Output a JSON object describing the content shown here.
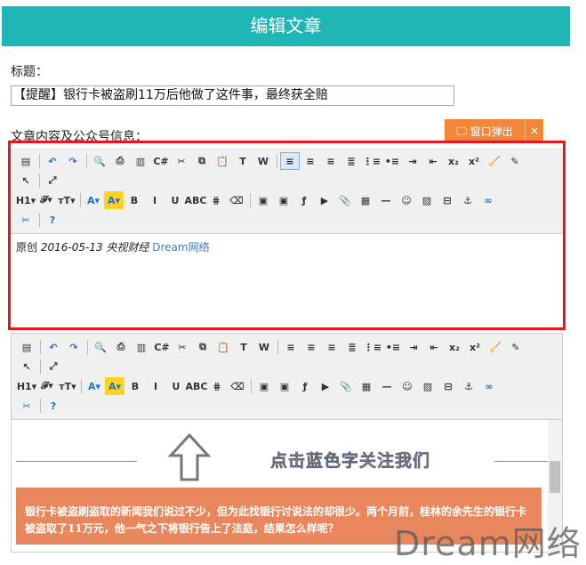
{
  "header": {
    "title": "编辑文章"
  },
  "form": {
    "title_label": "标题：",
    "title_value": "【提醒】银行卡被盗刷11万后他做了这件事，最终获全赔",
    "content_label": "文章内容及公众号信息：",
    "popout_label": "窗口弹出",
    "popout_close": "×"
  },
  "toolbar": {
    "row1": [
      [
        "source-icon",
        "▤"
      ],
      "|",
      [
        "undo-icon",
        "↶"
      ],
      [
        "redo-icon",
        "↷"
      ],
      "|",
      [
        "preview-icon",
        "🔍"
      ],
      [
        "print-icon",
        "⎙"
      ],
      [
        "template-icon",
        "▥"
      ],
      [
        "code-icon",
        "C#"
      ],
      [
        "cut-icon",
        "✂"
      ],
      [
        "copy-icon",
        "⧉"
      ],
      [
        "paste-icon",
        "📋"
      ],
      [
        "paste-text-icon",
        "T"
      ],
      [
        "paste-word-icon",
        "W"
      ],
      "|",
      [
        "align-left-icon",
        "≡"
      ],
      [
        "align-center-icon",
        "≡"
      ],
      [
        "align-right-icon",
        "≡"
      ],
      [
        "justify-icon",
        "≣"
      ],
      [
        "ordered-list-icon",
        "⋮≡"
      ],
      [
        "unordered-list-icon",
        "•≡"
      ],
      [
        "indent-icon",
        "⇥"
      ],
      [
        "outdent-icon",
        "⇤"
      ],
      [
        "subscript-icon",
        "x₂"
      ],
      [
        "superscript-icon",
        "x²"
      ],
      [
        "clear-format-icon",
        "🧹"
      ],
      [
        "select-all-icon",
        "✎"
      ]
    ],
    "row2": [
      [
        "pointer-icon",
        "↖"
      ],
      "|",
      [
        "fullscreen-icon",
        "⤢"
      ]
    ],
    "row3": [
      [
        "heading-icon",
        "H1▾"
      ],
      [
        "font-family-icon",
        "𝓕▾"
      ],
      [
        "font-size-icon",
        "тT▾"
      ],
      "|",
      [
        "font-color-icon",
        "A▾"
      ],
      [
        "highlight-color-icon",
        "A▾"
      ],
      [
        "bold-icon",
        "B"
      ],
      [
        "italic-icon",
        "I"
      ],
      [
        "underline-icon",
        "U"
      ],
      [
        "strikethrough-icon",
        "ABC"
      ],
      [
        "line-height-icon",
        "⋕"
      ],
      [
        "eraser-icon",
        "⌫"
      ],
      "|",
      [
        "image-icon",
        "▣"
      ],
      [
        "multi-image-icon",
        "▣"
      ],
      [
        "flash-icon",
        "ƒ"
      ],
      [
        "media-icon",
        "▶"
      ],
      [
        "attachment-icon",
        "📎"
      ],
      [
        "table-icon",
        "▦"
      ],
      [
        "hr-icon",
        "—"
      ],
      [
        "emoticon-icon",
        "☺"
      ],
      [
        "insert-image-icon",
        "▨"
      ],
      [
        "page-break-icon",
        "⊟"
      ],
      [
        "anchor-icon",
        "⚓"
      ],
      [
        "link-icon",
        "∞"
      ]
    ],
    "row4": [
      [
        "unlink-icon",
        "✂"
      ],
      "|",
      [
        "help-icon",
        "?"
      ]
    ]
  },
  "editor1": {
    "prefix": "原创",
    "date": "2016-05-13",
    "source": "央视财经",
    "account": "Dream网络"
  },
  "editor2": {
    "follow_prefix": "点击",
    "follow_blue": "蓝色字",
    "follow_suffix": "关注我们",
    "paragraph": "银行卡被盗刷盗取的新闻我们说过不少，但为此找银行讨说法的却很少。两个月前，桂林的余先生的银行卡被盗取了11万元，他一气之下将银行告上了法庭，结果怎么样呢？"
  },
  "watermark": "Dream网络"
}
